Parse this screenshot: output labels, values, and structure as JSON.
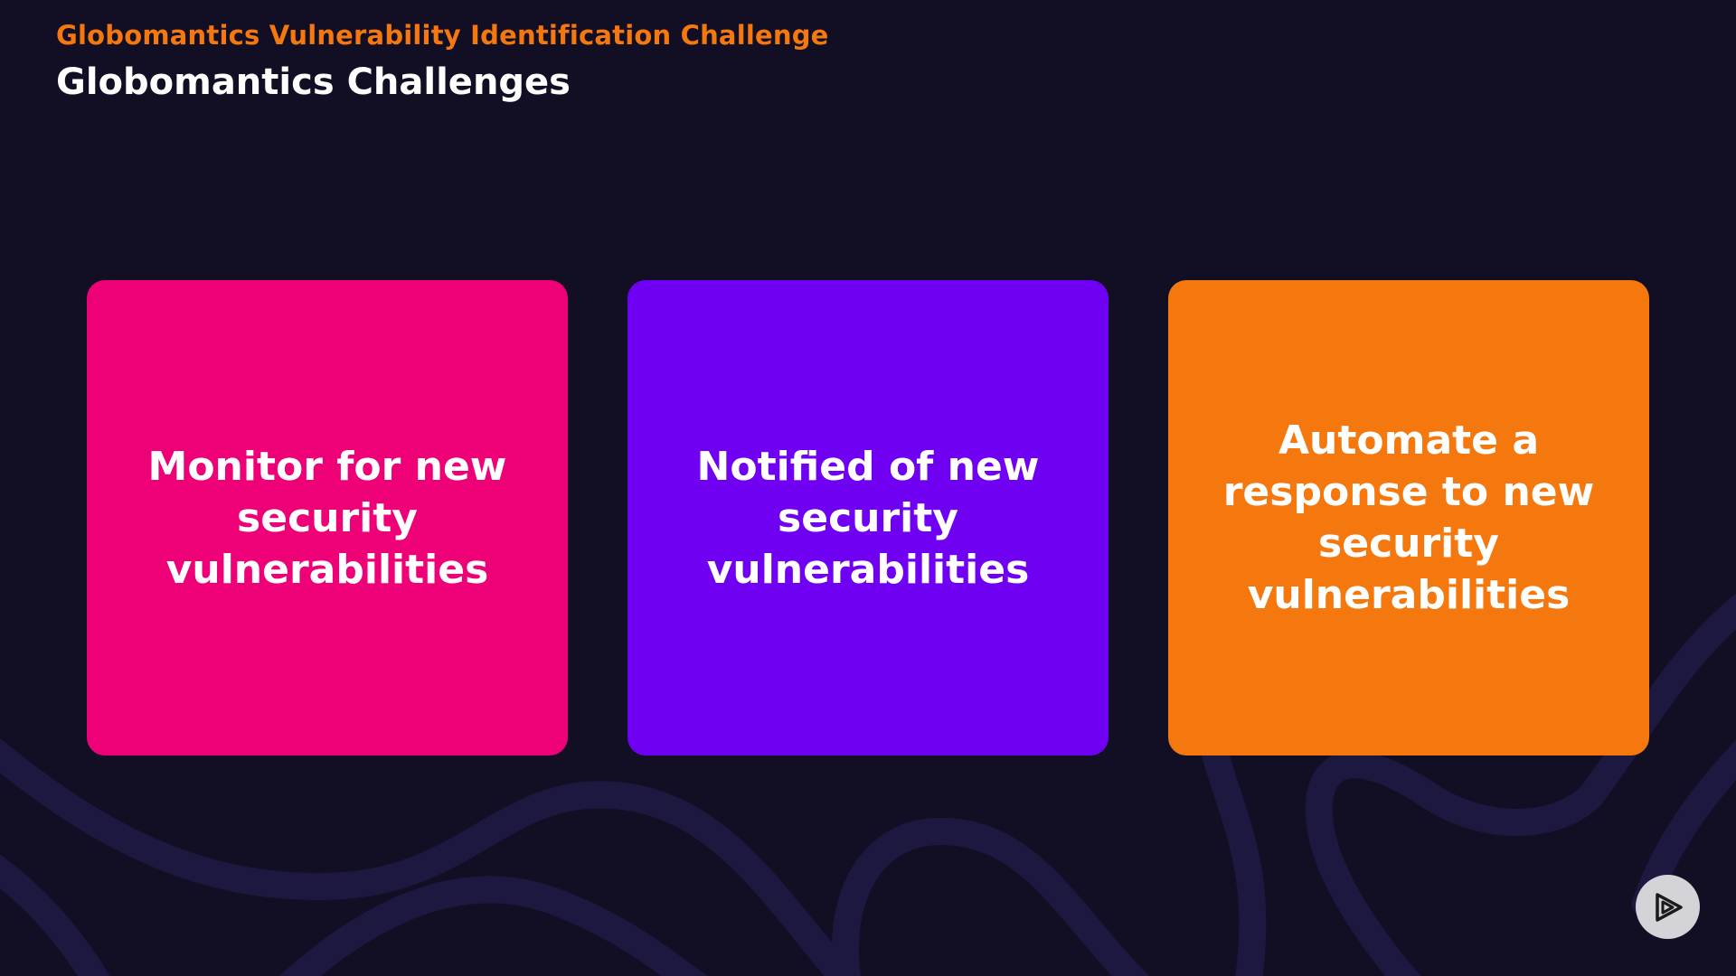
{
  "header": {
    "eyebrow": "Globomantics Vulnerability Identification Challenge",
    "title": "Globomantics Challenges"
  },
  "cards": [
    {
      "text": "Monitor for new security vulnerabilities",
      "color": "#ee0077"
    },
    {
      "text": "Notified of new security vulnerabilities",
      "color": "#7000f2"
    },
    {
      "text": "Automate a response to new security vulnerabilities",
      "color": "#f5780f"
    }
  ],
  "colors": {
    "background": "#120f24",
    "accent": "#f5780f",
    "decorative_lines": "#1d1840"
  },
  "icons": {
    "player": "play-logo-icon"
  }
}
